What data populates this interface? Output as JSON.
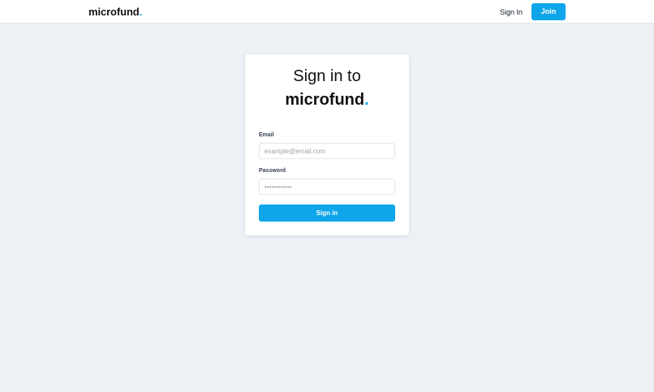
{
  "header": {
    "brand_text": "microfund",
    "brand_dot": ".",
    "signin_label": "Sign In",
    "join_label": "Join"
  },
  "form": {
    "title_line1": "Sign in to",
    "title_brand": "microfund",
    "title_dot": ".",
    "email_label": "Email",
    "email_placeholder": "example@email.com",
    "email_value": "",
    "password_label": "Password",
    "password_placeholder": "••••••••••••",
    "password_value": "",
    "submit_label": "Sign in"
  },
  "colors": {
    "accent": "#0ea5e9",
    "background": "#edf1f5",
    "card": "#ffffff"
  }
}
